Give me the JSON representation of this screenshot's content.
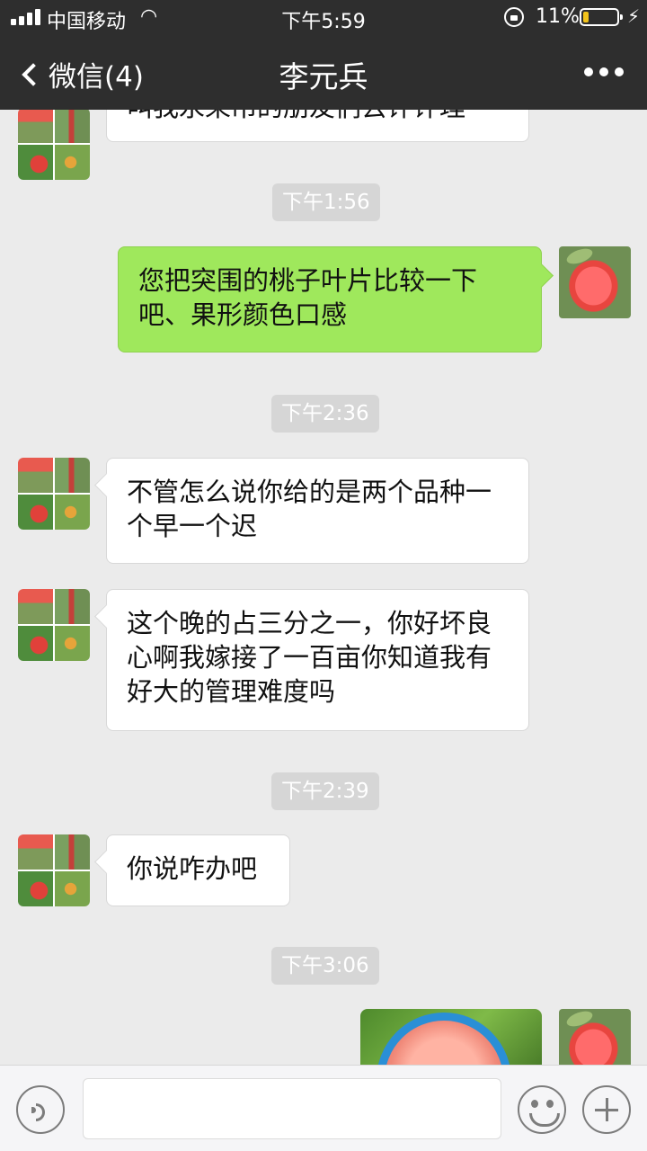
{
  "status_bar": {
    "carrier": "中国移动",
    "time": "下午5:59",
    "battery": "11%"
  },
  "nav": {
    "back_label": "微信(4)",
    "title": "李元兵"
  },
  "messages": {
    "m0": {
      "text": "叫我永呆吊的朋友们去评评理"
    },
    "t1": "下午1:56",
    "m1": {
      "text": "您把突围的桃子叶片比较一下吧、果形颜色口感"
    },
    "t2": "下午2:36",
    "m2": {
      "text": "不管怎么说你给的是两个品种一个早一个迟"
    },
    "m3": {
      "text": "这个晚的占三分之一，你好坏良心啊我嫁接了一百亩你知道我有好大的管理难度吗"
    },
    "t3": "下午2:39",
    "m4": {
      "text": "你说咋办吧"
    },
    "t4": "下午3:06"
  },
  "icons": {
    "voice": "voice-icon",
    "emoji": "emoji-icon",
    "plus": "plus-icon",
    "more": "more-icon",
    "back": "chevron-left-icon"
  },
  "colors": {
    "header": "#2e2e2e",
    "background": "#ebebeb",
    "outgoing_bubble": "#9fe85c",
    "incoming_bubble": "#ffffff"
  }
}
